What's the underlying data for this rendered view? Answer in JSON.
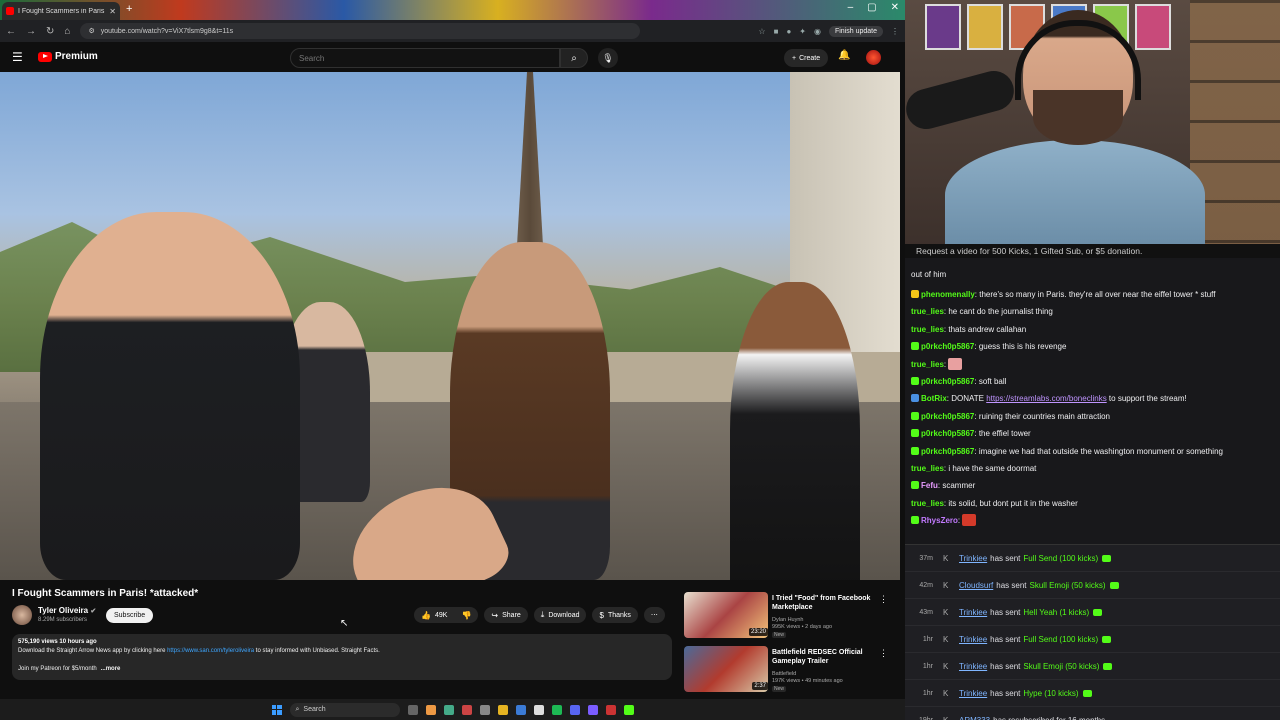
{
  "browser": {
    "tab_title": "I Fought Scammers in Paris",
    "url": "youtube.com/watch?v=ViX7tlsm9g8&t=11s",
    "finish_update": "Finish update"
  },
  "yt": {
    "logo_text": "Premium",
    "search_placeholder": "Search",
    "create_label": "Create"
  },
  "video": {
    "title": "I Fought Scammers in Paris! *attacked*",
    "channel": "Tyler Oliveira",
    "subscribers": "8.29M subscribers",
    "subscribe_label": "Subscribe",
    "likes": "49K",
    "share": "Share",
    "download": "Download",
    "thanks": "Thanks",
    "description": {
      "meta": "575,190 views  10 hours ago",
      "line_prefix": "Download the Straight Arrow News app by clicking here ",
      "link": "https://www.san.com/tyleroliveira",
      "line_suffix": " to stay informed with Unbiased. Straight Facts.",
      "patreon": "Join my Patreon for $5/month",
      "more": "...more"
    }
  },
  "recommendations": [
    {
      "title": "I Tried \"Food\" from Facebook Marketplace",
      "channel": "Dylan Huynh",
      "meta": "995K views • 2 days ago",
      "badge": "New",
      "duration": "23:20"
    },
    {
      "title": "Battlefield REDSEC Official Gameplay Trailer",
      "channel": "Battlefield",
      "meta": "197K views • 49 minutes ago",
      "badge": "New",
      "duration": "2:37"
    }
  ],
  "taskbar": {
    "search_label": "Search"
  },
  "chat": {
    "banner": "Request a video for 500 Kicks, 1 Gifted Sub, or $5 donation.",
    "continuation": "out of him",
    "messages": [
      {
        "user": "phenomenally",
        "color": "#53fc18",
        "text": "there's so many in Paris. they're all over near the eiffel tower * stuff"
      },
      {
        "user": "true_lies",
        "color": "#53fc18",
        "text": "he cant do the journalist thing"
      },
      {
        "user": "true_lies",
        "color": "#53fc18",
        "text": "thats andrew callahan"
      },
      {
        "user": "p0rkch0p5867",
        "color": "#53fc18",
        "text": "guess this is his revenge"
      },
      {
        "user": "true_lies",
        "color": "#53fc18",
        "text": ""
      },
      {
        "user": "p0rkch0p5867",
        "color": "#53fc18",
        "text": "soft ball"
      },
      {
        "user": "BotRix",
        "color": "#53fc18",
        "text": "DONATE ",
        "link": "https://streamlabs.com/boneclinks",
        "text_after": " to support the stream!"
      },
      {
        "user": "p0rkch0p5867",
        "color": "#53fc18",
        "text": "ruining their countries main attraction"
      },
      {
        "user": "p0rkch0p5867",
        "color": "#53fc18",
        "text": "the effiel tower"
      },
      {
        "user": "p0rkch0p5867",
        "color": "#53fc18",
        "text": "imagine we had that outside the washington monument or something"
      },
      {
        "user": "true_lies",
        "color": "#53fc18",
        "text": "i have the same doormat"
      },
      {
        "user": "Fefu",
        "color": "#e89cff",
        "text": "scammer"
      },
      {
        "user": "true_lies",
        "color": "#53fc18",
        "text": "its solid, but dont put it in the washer"
      },
      {
        "user": "RhysZero",
        "color": "#c27aff",
        "text": ""
      }
    ]
  },
  "events": [
    {
      "time": "37m",
      "user": "Trinkiee",
      "action": "has sent",
      "item": "Full Send (100 kicks)"
    },
    {
      "time": "42m",
      "user": "Cloudsurf",
      "action": "has sent",
      "item": "Skull Emoji (50 kicks)"
    },
    {
      "time": "43m",
      "user": "Trinkiee",
      "action": "has sent",
      "item": "Hell Yeah (1 kicks)"
    },
    {
      "time": "1hr",
      "user": "Trinkiee",
      "action": "has sent",
      "item": "Full Send (100 kicks)"
    },
    {
      "time": "1hr",
      "user": "Trinkiee",
      "action": "has sent",
      "item": "Skull Emoji (50 kicks)"
    },
    {
      "time": "1hr",
      "user": "Trinkiee",
      "action": "has sent",
      "item": "Hype (10 kicks)"
    },
    {
      "time": "19hr",
      "user": "ARM333",
      "action": "has resubscribed for 16 months",
      "item": ""
    }
  ],
  "colors": {
    "accent": "#ff0000",
    "kick_green": "#53fc18",
    "chat_bg": "#18181b"
  }
}
